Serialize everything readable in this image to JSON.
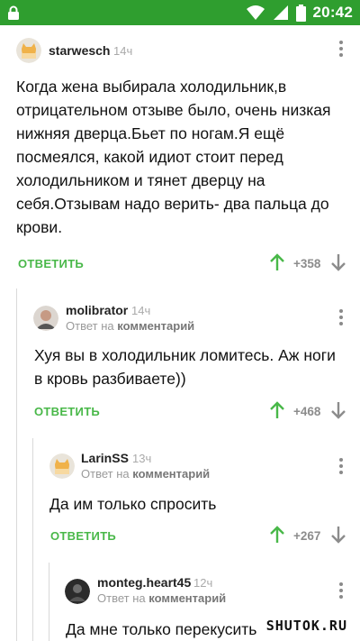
{
  "status_bar": {
    "time": "20:42"
  },
  "comments": [
    {
      "username": "starwesch",
      "time": "14ч",
      "body": "Когда жена выбирала холодильник,в отрицательном отзыве было, очень низкая нижняя дверца.Бьет по ногам.Я ещё посмеялся, какой идиот стоит перед холодильником и тянет дверцу на себя.Отзывам надо верить- два пальца до крови.",
      "reply_label": "ОТВЕТИТЬ",
      "rating": "+358"
    },
    {
      "username": "molibrator",
      "time": "14ч",
      "reply_prefix": "Ответ на",
      "reply_target": "комментарий",
      "body": "Хуя вы в холодильник ломитесь. Аж ноги в кровь разбиваете))",
      "reply_label": "ОТВЕТИТЬ",
      "rating": "+468"
    },
    {
      "username": "LarinSS",
      "time": "13ч",
      "reply_prefix": "Ответ на",
      "reply_target": "комментарий",
      "body": "Да им только спросить",
      "reply_label": "ОТВЕТИТЬ",
      "rating": "+267"
    },
    {
      "username": "monteg.heart45",
      "time": "12ч",
      "reply_prefix": "Ответ на",
      "reply_target": "комментарий",
      "body": "Да мне только перекусить"
    }
  ],
  "watermark": "SHUTOK.RU",
  "colors": {
    "status_bar": "#2f9e2f",
    "accent_green": "#49b849",
    "rating_gray": "#8c8c8c"
  },
  "icons": [
    "lock-icon",
    "wifi-icon",
    "signal-icon",
    "battery-icon",
    "more-vertical-icon",
    "arrow-up-icon",
    "arrow-down-icon"
  ]
}
